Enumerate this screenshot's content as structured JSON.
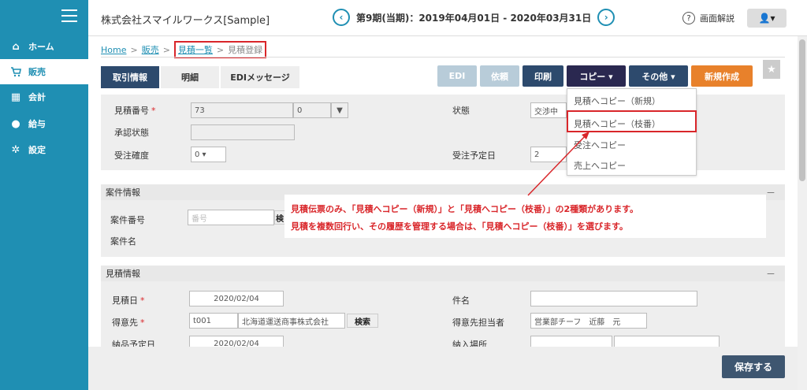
{
  "sidebar": {
    "items": [
      {
        "label": "ホーム",
        "icon": "home-icon",
        "glyph": "⌂"
      },
      {
        "label": "販売",
        "icon": "cart-icon",
        "glyph": "🛒"
      },
      {
        "label": "会計",
        "icon": "calculator-icon",
        "glyph": "▦"
      },
      {
        "label": "給与",
        "icon": "money-bag-icon",
        "glyph": "●"
      },
      {
        "label": "設定",
        "icon": "gear-icon",
        "glyph": "✲"
      }
    ],
    "active_index": 1
  },
  "header": {
    "company": "株式会社スマイルワークス[Sample]",
    "period": "第9期(当期)：2019年04月01日 - 2020年03月31日",
    "prev_glyph": "‹",
    "next_glyph": "›",
    "help_label": "画面解説",
    "help_glyph": "?",
    "user_glyph": "👤▾"
  },
  "breadcrumb": {
    "home": "Home",
    "sales": "販売",
    "list": "見積一覧",
    "current": "見積登録",
    "sep": ">"
  },
  "tabs": [
    {
      "label": "取引情報",
      "active": true
    },
    {
      "label": "明細",
      "active": false
    },
    {
      "label": "EDIメッセージ",
      "active": false
    }
  ],
  "toolbar": {
    "edi": "EDI",
    "request": "依頼",
    "print": "印刷",
    "copy": "コピー ▾",
    "other": "その他 ▾",
    "new": "新規作成",
    "star": "★"
  },
  "top_panel": {
    "estimate_no_label": "見積番号",
    "estimate_no_value": "73",
    "estimate_branch_value": "0",
    "approval_label": "承認状態",
    "approval_value": "",
    "confidence_label": "受注確度",
    "confidence_value": "0 ▾",
    "status_label": "状態",
    "status_value": "交渉中",
    "order_date_label": "受注予定日",
    "order_date_value": "2",
    "required_mark": "*"
  },
  "dropdown": {
    "items": [
      "見積へコピー（新規）",
      "見積へコピー（枝番）",
      "受注へコピー",
      "売上へコピー"
    ]
  },
  "project_panel": {
    "title": "案件情報",
    "collapse": "－",
    "project_no_label": "案件番号",
    "project_no_placeholder": "番号",
    "project_search": "検",
    "project_name_label": "案件名"
  },
  "callout": {
    "line1": "見積伝票のみ、「見積へコピー（新規）」と「見積へコピー（枝番）」の2種類があります。",
    "line2": "見積を複数回行い、その履歴を管理する場合は、「見積へコピー（枝番）」を選びます。"
  },
  "estimate_panel": {
    "title": "見積情報",
    "collapse": "－",
    "date_label": "見積日",
    "date_value": "2020/02/04",
    "customer_label": "得意先",
    "customer_code": "t001",
    "customer_name": "北海道運送商事株式会社",
    "search": "検索",
    "subject_label": "件名",
    "subject_value": "",
    "contact_label": "得意先担当者",
    "contact_value": "営業部チーフ　近藤　元",
    "delivery_label": "納品予定日",
    "delivery_value": "2020/02/04",
    "place_label": "納入場所"
  },
  "footer": {
    "save": "保存する"
  }
}
